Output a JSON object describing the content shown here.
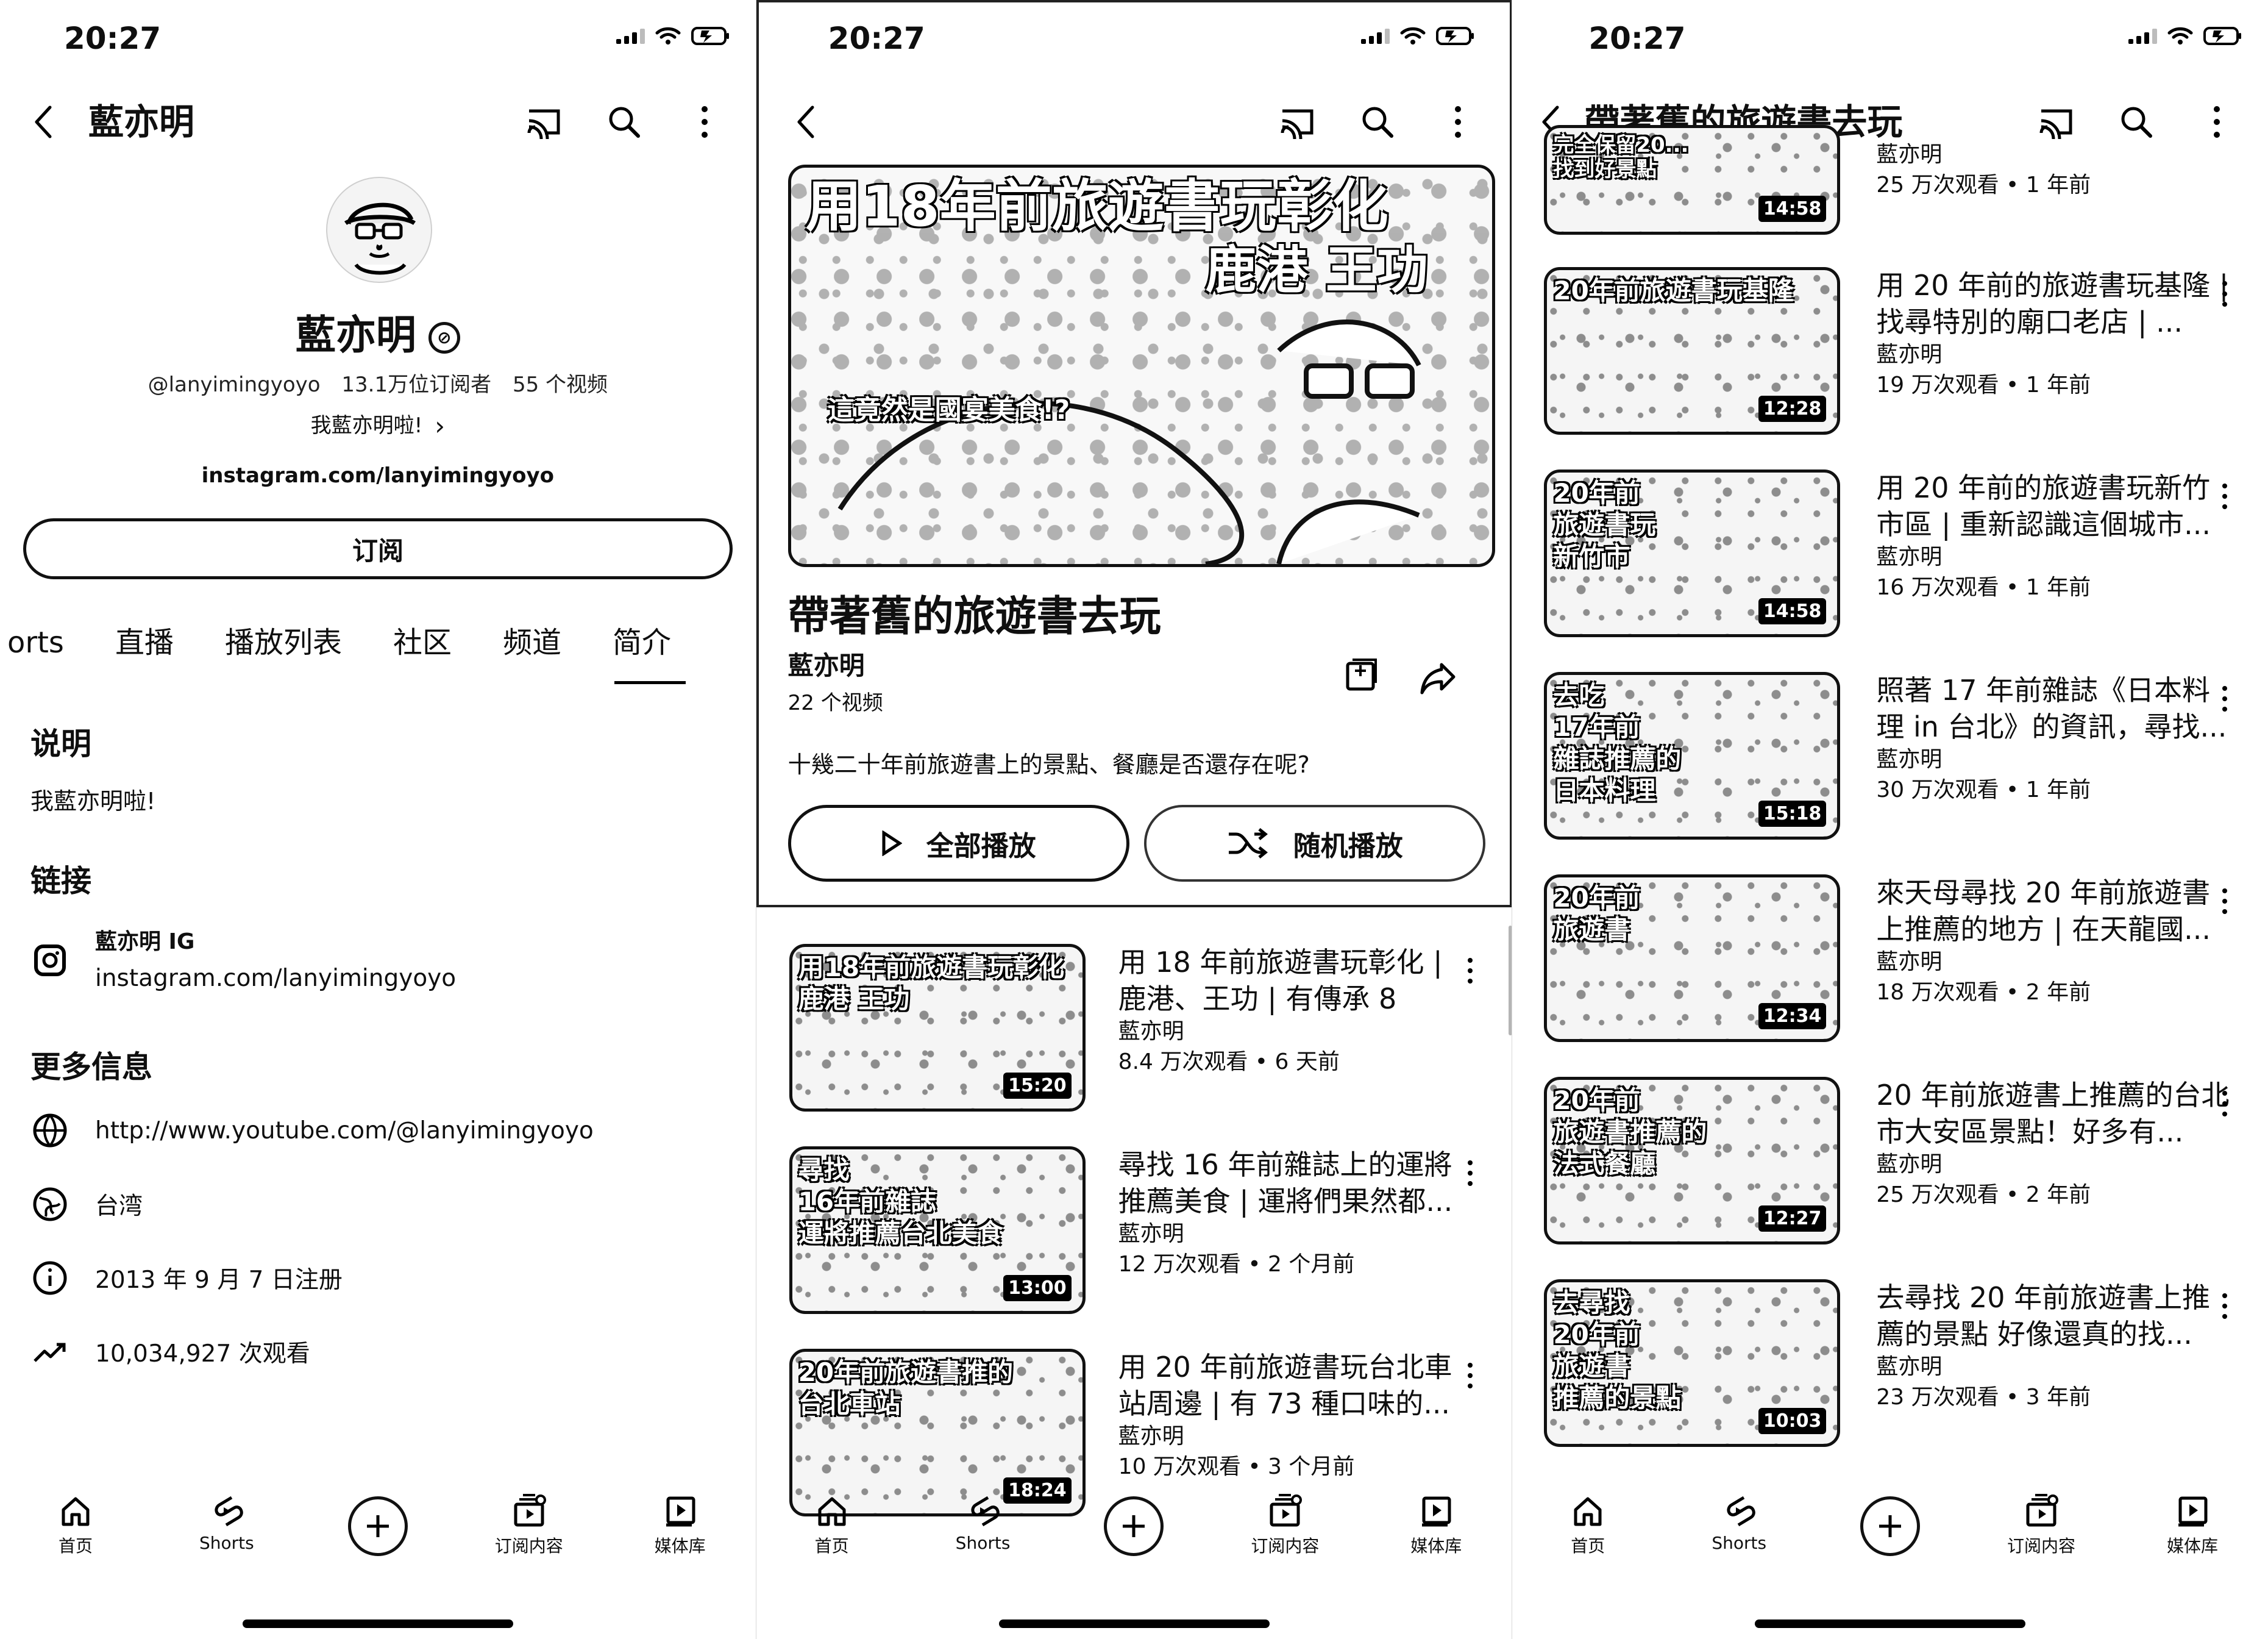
{
  "screens": [
    {
      "status_time": "20:27",
      "app_title": "藍亦明",
      "channel": {
        "name": "藍亦明",
        "handle": "@lanyimingyoyo",
        "subscribers": "13.1万位订阅者",
        "videos": "55 个视频",
        "tagline": "我藍亦明啦!",
        "link": "instagram.com/lanyimingyoyo",
        "subscribe_label": "订阅"
      },
      "tabs": [
        "orts",
        "直播",
        "播放列表",
        "社区",
        "频道",
        "简介"
      ],
      "about": {
        "description_title": "说明",
        "description": "我藍亦明啦!",
        "links_title": "链接",
        "ig_label": "藍亦明 IG",
        "ig_url": "instagram.com/lanyimingyoyo",
        "more_title": "更多信息",
        "youtube_url": "http://www.youtube.com/@lanyimingyoyo",
        "country": "台湾",
        "joined": "2013 年 9 月 7 日注册",
        "views": "10,034,927 次观看"
      }
    },
    {
      "status_time": "20:27",
      "playlist": {
        "hero_title_line1": "用18年前旅遊書玩彰化",
        "hero_title_line2": "鹿港 王功",
        "hero_caption": "這竟然是國宴美食!?",
        "title": "帶著舊的旅遊書去玩",
        "owner": "藍亦明",
        "count": "22 个视频",
        "description": "十幾二十年前旅遊書上的景點、餐廳是否還存在呢?",
        "play_all": "全部播放",
        "shuffle": "随机播放"
      },
      "videos": [
        {
          "thumb_text": "用18年前旅遊書玩彰化\n鹿港 王功",
          "duration": "15:20",
          "title": "用 18 年前旅遊書玩彰化 | 鹿港、王功 | 有傳承 8 代...",
          "owner": "藍亦明",
          "stats": "8.4 万次观看 • 6 天前"
        },
        {
          "thumb_text": "尋找\n16年前雜誌\n運將推薦台北美食",
          "duration": "13:00",
          "title": "尋找 16 年前雜誌上的運將推薦美食 | 運將們果然都...",
          "owner": "藍亦明",
          "stats": "12 万次观看 • 2 个月前"
        },
        {
          "thumb_text": "20年前旅遊書推的\n台北車站",
          "duration": "18:24",
          "title": "用 20 年前旅遊書玩台北車站周邊 | 有 73 種口味的...",
          "owner": "藍亦明",
          "stats": "10 万次观看 • 3 个月前"
        }
      ]
    },
    {
      "status_time": "20:27",
      "app_title": "帶著舊的旅遊書去玩",
      "partial_first": {
        "thumb_text": "完全保留20...\n找到好景點",
        "duration": "14:58",
        "owner": "藍亦明",
        "stats": "25 万次观看 • 1 年前"
      },
      "videos": [
        {
          "thumb_text": "20年前旅遊書玩基隆",
          "duration": "12:28",
          "title": "用 20 年前的旅遊書玩基隆 | 找尋特別的廟口老店 | ...",
          "owner": "藍亦明",
          "stats": "19 万次观看 • 1 年前"
        },
        {
          "thumb_text": "20年前\n旅遊書玩\n新竹市",
          "duration": "14:58",
          "title": "用 20 年前的旅遊書玩新竹市區 | 重新認識這個城市...",
          "owner": "藍亦明",
          "stats": "16 万次观看 • 1 年前"
        },
        {
          "thumb_text": "去吃\n17年前\n雜誌推薦的\n日本料理",
          "duration": "15:18",
          "title": "照著 17 年前雜誌《日本料理 in 台北》的資訊，尋找...",
          "owner": "藍亦明",
          "stats": "30 万次观看 • 1 年前"
        },
        {
          "thumb_text": "20年前\n旅遊書",
          "duration": "12:34",
          "title": "來天母尋找 20 年前旅遊書上推薦的地方 | 在天龍國...",
          "owner": "藍亦明",
          "stats": "18 万次观看 • 2 年前"
        },
        {
          "thumb_text": "20年前\n旅遊書推薦的\n法式餐廳",
          "duration": "12:27",
          "title": "20 年前旅遊書上推薦的台北市大安區景點！好多有...",
          "owner": "藍亦明",
          "stats": "25 万次观看 • 2 年前"
        },
        {
          "thumb_text": "去尋找\n20年前\n旅遊書\n推薦的景點",
          "duration": "10:03",
          "title": "去尋找 20 年前旅遊書上推薦的景點 好像還真的找...",
          "owner": "藍亦明",
          "stats": "23 万次观看 • 3 年前"
        }
      ]
    }
  ],
  "nav": {
    "home": "首页",
    "shorts": "Shorts",
    "subscriptions": "订阅内容",
    "library": "媒体库"
  },
  "icons": {
    "cast": "cast-icon",
    "search": "search-icon",
    "more": "more-vertical-icon",
    "back": "back-icon",
    "shuffle": "shuffle-icon",
    "play": "play-icon",
    "save": "save-playlist-icon",
    "share": "share-icon",
    "globe": "globe-icon",
    "info": "info-icon",
    "trend": "trending-icon",
    "instagram": "instagram-icon"
  }
}
